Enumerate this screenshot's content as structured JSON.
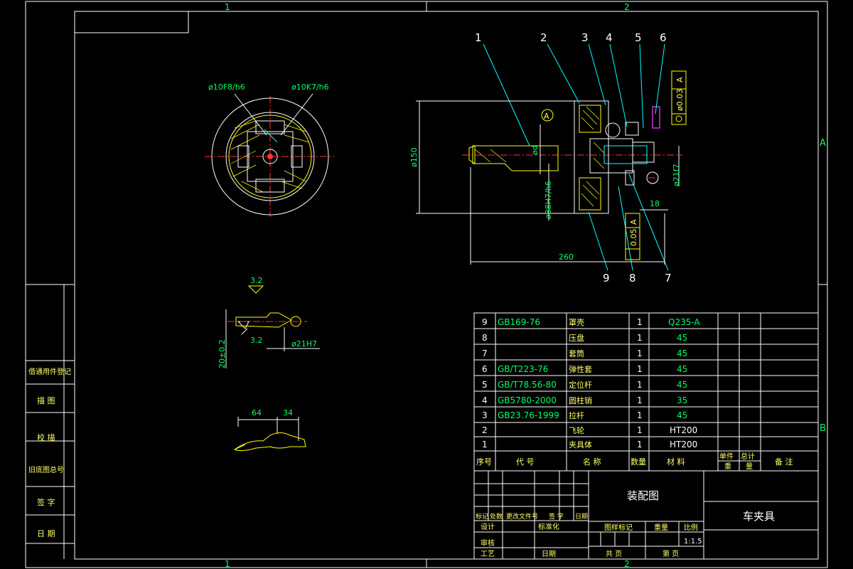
{
  "frame": {
    "zone_top_1": "1",
    "zone_top_2": "2",
    "zone_bottom_1": "1",
    "zone_bottom_2": "2",
    "zone_right_a": "A",
    "zone_right_b": "B"
  },
  "left_margin": {
    "labels": [
      "借通用件登记",
      "描 图",
      "校 描",
      "旧底图总号",
      "签 字",
      "日 期"
    ]
  },
  "end_view": {
    "fit_left": "ø10F8/h6",
    "fit_right": "ø10K7/h6"
  },
  "main_view": {
    "balloons": [
      "1",
      "2",
      "3",
      "4",
      "5",
      "6",
      "7",
      "8",
      "9"
    ],
    "datum": "A",
    "dim_dia150": "ø150",
    "dim_od": "ød",
    "dim_38": "ø38H7/h6",
    "dim_21f7": "ø21f7",
    "dim_18": "18",
    "dim_260": "260",
    "tol_top_value": "ø0.03",
    "tol_top_datum": "A",
    "tol_bottom_value": "0.05",
    "tol_bottom_datum": "A"
  },
  "pin_detail": {
    "roughness1": "3.2",
    "roughness2": "3.2",
    "dim_20": "20±0.2",
    "dim_21": "ø21H7"
  },
  "lever_detail": {
    "dim_64": "64",
    "dim_34": "34"
  },
  "bom": {
    "rows": [
      {
        "no": "9",
        "code": "GB169-76",
        "name": "罩壳",
        "qty": "1",
        "material": "Q235-A"
      },
      {
        "no": "8",
        "code": "",
        "name": "压盘",
        "qty": "1",
        "material": "45"
      },
      {
        "no": "7",
        "code": "",
        "name": "套筒",
        "qty": "1",
        "material": "45"
      },
      {
        "no": "6",
        "code": "GB/T223-76",
        "name": "弹性套",
        "qty": "1",
        "material": "45"
      },
      {
        "no": "5",
        "code": "GB/T78.56-80",
        "name": "定位杆",
        "qty": "1",
        "material": "45"
      },
      {
        "no": "4",
        "code": "GB5780-2000",
        "name": "圆柱销",
        "qty": "1",
        "material": "35"
      },
      {
        "no": "3",
        "code": "GB23.76-1999",
        "name": "拉杆",
        "qty": "1",
        "material": "45"
      },
      {
        "no": "2",
        "code": "",
        "name": "飞轮",
        "qty": "1",
        "material": "HT200"
      },
      {
        "no": "1",
        "code": "",
        "name": "夹具体",
        "qty": "1",
        "material": "HT200"
      }
    ],
    "header": {
      "no": "序号",
      "code": "代 号",
      "name": "名 称",
      "qty": "数量",
      "material": "材 料",
      "unit_top": "单件",
      "total_top": "总计",
      "unit_bottom": "重",
      "total_bottom": "量",
      "remark": "备 注"
    }
  },
  "title_block": {
    "drawing_type": "装配图",
    "part_name": "车夹具",
    "row_a": [
      "标记",
      "处数",
      "更改文件号",
      "签 字",
      "日期"
    ],
    "row_b": [
      "设计",
      "",
      "标准化"
    ],
    "row_c": [
      "审核"
    ],
    "row_d": [
      "工艺",
      "",
      "日期"
    ],
    "stage_label": "图样标记",
    "weight_label": "重量",
    "scale_label": "比例",
    "scale_value": "1:1.5",
    "sheets_total": "共 页",
    "sheet_no": "第 页"
  }
}
